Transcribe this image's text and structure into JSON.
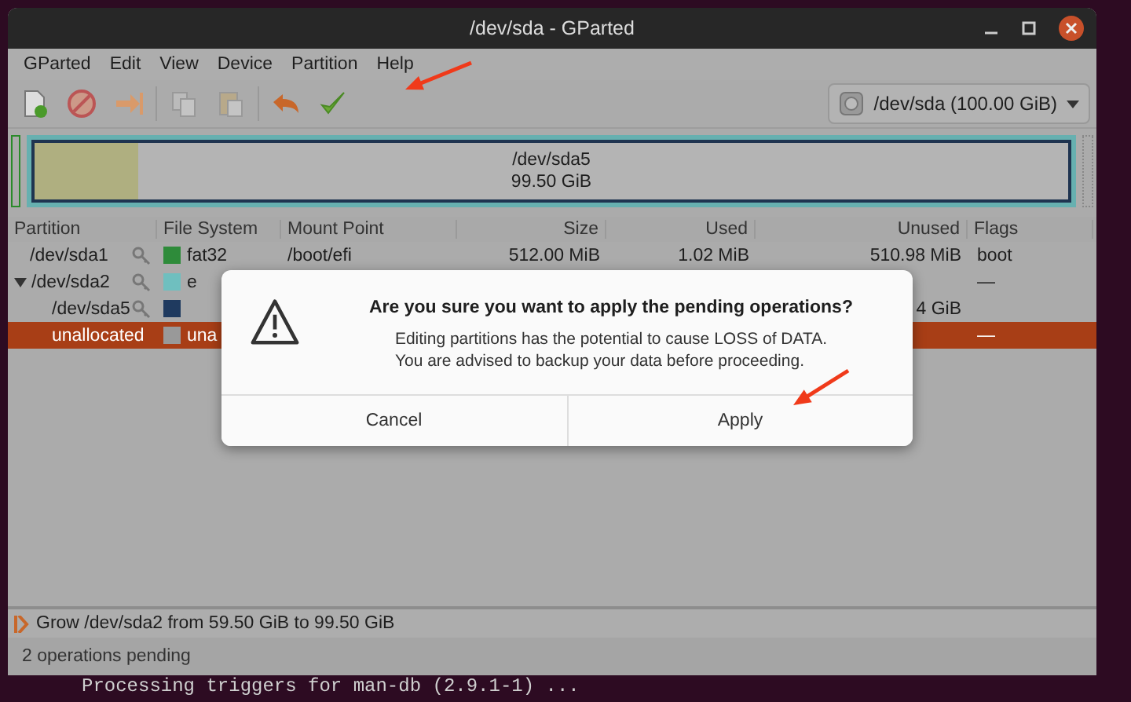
{
  "terminal": {
    "line": "Processing triggers for man-db (2.9.1-1) ..."
  },
  "window": {
    "title": "/dev/sda - GParted"
  },
  "menu": [
    "GParted",
    "Edit",
    "View",
    "Device",
    "Partition",
    "Help"
  ],
  "toolbar": [
    {
      "kind": "new"
    },
    {
      "kind": "delete"
    },
    {
      "kind": "resize"
    },
    {
      "kind": "sep"
    },
    {
      "kind": "copy"
    },
    {
      "kind": "paste"
    },
    {
      "kind": "sep"
    },
    {
      "kind": "undo"
    },
    {
      "kind": "apply"
    }
  ],
  "device_selector": {
    "value": "/dev/sda (100.00 GiB)"
  },
  "disk_map": {
    "label": "/dev/sda5",
    "size": "99.50 GiB",
    "level": 0.1
  },
  "table": {
    "columns": [
      "Partition",
      "File System",
      "Mount Point",
      "Size",
      "Used",
      "Unused",
      "Flags"
    ],
    "rows": [
      {
        "partition": "/dev/sda1",
        "locked": true,
        "color": "#2e8b3a",
        "filesystem": "fat32",
        "mount": "/boot/efi",
        "size": "512.00 MiB",
        "used": "1.02 MiB",
        "unused": "510.98 MiB",
        "flags": "boot",
        "selected": false
      },
      {
        "partition": "/dev/sda2",
        "locked": true,
        "color": "#6fbfbf",
        "filesystem": "e",
        "flags": "—",
        "selected": false,
        "expanded": true,
        "children": [
          {
            "partition": "/dev/sda5",
            "locked": true,
            "color": "#1f3a5f",
            "unused": "4 GiB",
            "selected": false
          },
          {
            "partition": "unallocated",
            "locked": false,
            "color": "#999999",
            "filesystem": "una",
            "flags": "—",
            "selected": true
          }
        ]
      }
    ]
  },
  "dialog": {
    "title": "Are you sure you want to apply the pending operations?",
    "message": [
      "Editing partitions has the potential to cause LOSS of DATA.",
      "You are advised to backup your data before proceeding."
    ],
    "buttons": [
      "Cancel",
      "Apply"
    ]
  },
  "operations": [
    {
      "text": "Grow /dev/sda2 from 59.50 GiB to 99.50 GiB"
    }
  ],
  "status_bar": {
    "text": "2 operations pending"
  }
}
